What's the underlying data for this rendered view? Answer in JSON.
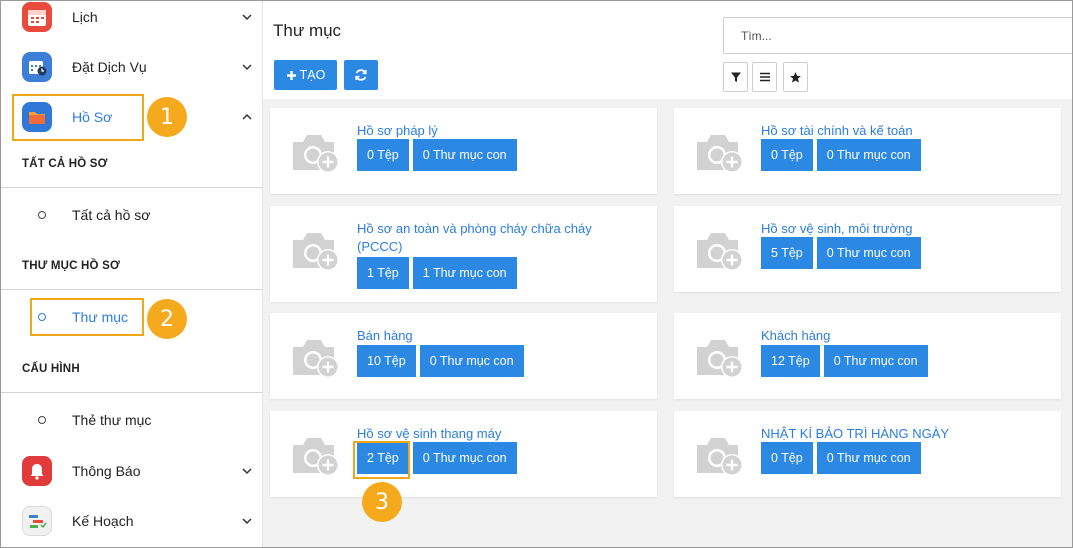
{
  "sidebar": {
    "items": [
      {
        "label": "Lịch"
      },
      {
        "label": "Đặt Dịch Vụ"
      },
      {
        "label": "Hồ Sơ"
      },
      {
        "label": "Thông Báo"
      },
      {
        "label": "Kế Hoạch"
      }
    ],
    "sections": {
      "all_header": "TẤT CẢ HỒ SƠ",
      "all_item": "Tất cả hồ sơ",
      "folder_header": "THƯ MỤC HỒ SƠ",
      "folder_item": "Thư mục",
      "config_header": "CẤU HÌNH",
      "config_item": "Thẻ thư mục"
    }
  },
  "main": {
    "title": "Thư mục",
    "create_label": "TẠO",
    "search_placeholder": "Tìm...",
    "folders": [
      {
        "title": "Hồ sơ pháp lý",
        "files": "0 Tệp",
        "subfolders": "0 Thư mục con"
      },
      {
        "title": "Hồ sơ tài chính và kế toán",
        "files": "0 Tệp",
        "subfolders": "0 Thư mục con"
      },
      {
        "title": "Hồ sơ an toàn và phòng cháy chữa cháy (PCCC)",
        "files": "1 Tệp",
        "subfolders": "1 Thư mục con"
      },
      {
        "title": "Hồ sơ vệ sinh, môi trường",
        "files": "5 Tệp",
        "subfolders": "0 Thư mục con"
      },
      {
        "title": "Bán hàng",
        "files": "10 Tệp",
        "subfolders": "0 Thư mục con"
      },
      {
        "title": "Khách hàng",
        "files": "12 Tệp",
        "subfolders": "0 Thư mục con"
      },
      {
        "title": "Hồ sơ vệ sinh thang máy",
        "files": "2 Tệp",
        "subfolders": "0 Thư mục con"
      },
      {
        "title": "NHẬT KÍ BẢO TRÌ HÀNG NGÀY",
        "files": "0 Tệp",
        "subfolders": "0 Thư mục con"
      }
    ]
  },
  "annotations": {
    "step1": "1",
    "step2": "2",
    "step3": "3"
  },
  "colors": {
    "accent": "#2b88e3",
    "highlight": "#f0a818"
  }
}
